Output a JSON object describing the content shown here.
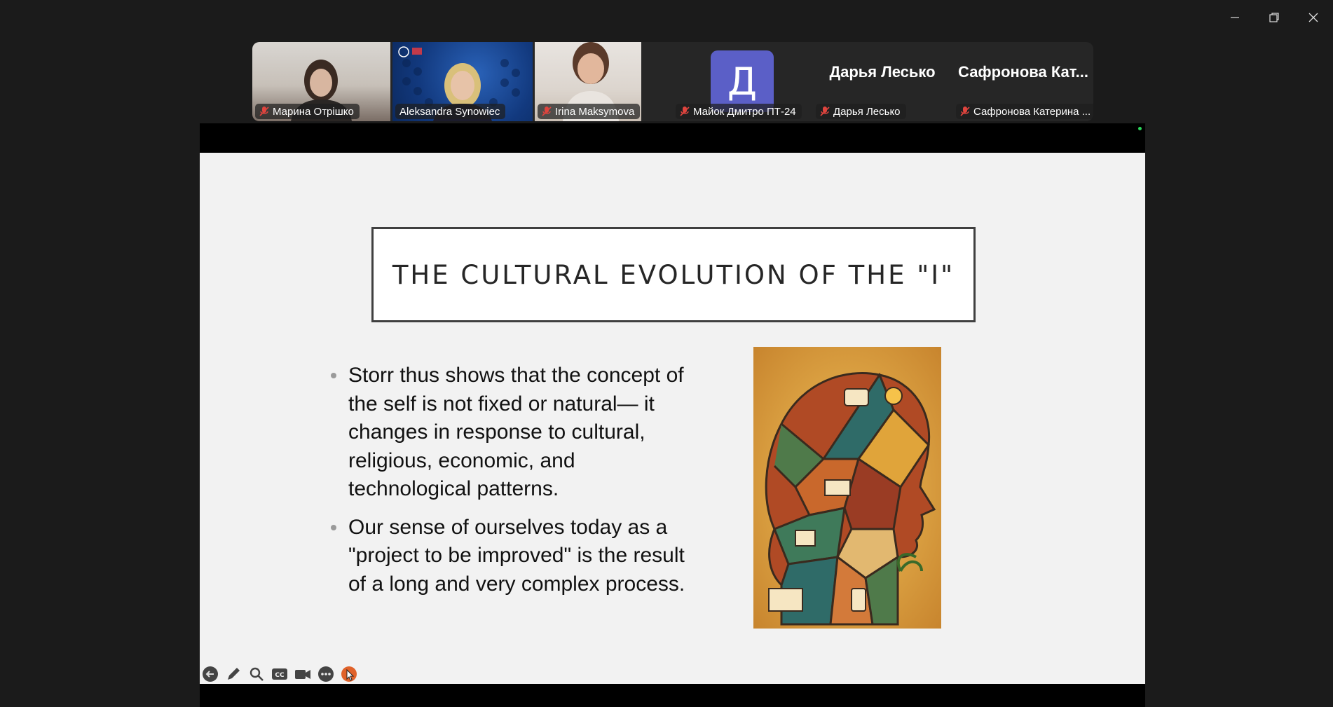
{
  "window_controls": {
    "minimize": "minimize-icon",
    "restore": "restore-icon",
    "close": "close-icon"
  },
  "participants": [
    {
      "name": "Марина Отрішко",
      "muted": true,
      "type": "video"
    },
    {
      "name": "Aleksandra Synowiec",
      "muted": false,
      "type": "video",
      "active_speaker": true
    },
    {
      "name": "Irina Maksymova",
      "muted": true,
      "type": "video"
    },
    {
      "name": "Майок Дмитро ПТ-24",
      "muted": true,
      "type": "avatar",
      "avatar_letter": "Д"
    },
    {
      "name": "Дарья Лесько",
      "muted": true,
      "type": "name",
      "display_name": "Дарья Лесько"
    },
    {
      "name": "Сафронова Катерина ...",
      "muted": true,
      "type": "name",
      "display_name": "Сафронова  Кат..."
    }
  ],
  "slide": {
    "title": "THE CULTURAL EVOLUTION OF THE \"I\"",
    "bullets": [
      "Storr thus shows that the concept of the self is not fixed or natural— it changes in response to cultural, religious, economic, and technological patterns.",
      "Our sense of ourselves today as a \"project to be improved\" is the result of a long and very complex process."
    ]
  },
  "slide_toolbar": [
    "back-arrow-icon",
    "pen-icon",
    "zoom-icon",
    "captions-icon",
    "video-camera-icon",
    "more-icon",
    "pointer-icon"
  ],
  "colors": {
    "active_speaker": "#23d96b",
    "avatar_bg": "#5b5fc7",
    "mute": "#e0443e"
  }
}
